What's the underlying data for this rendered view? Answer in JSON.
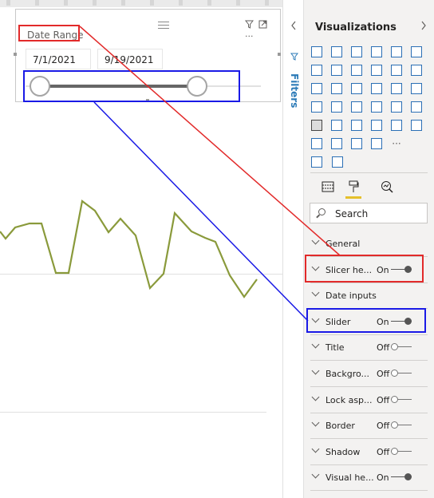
{
  "slicer": {
    "title": "Date Range",
    "start_date": "7/1/2021",
    "end_date": "9/19/2021",
    "range": {
      "start_fraction": 0.0,
      "end_fraction": 1.0
    }
  },
  "filters_pane": {
    "label": "Filters"
  },
  "visualizations_pane": {
    "title": "Visualizations",
    "more_glyph": "···",
    "search_placeholder": "Search",
    "sections": [
      {
        "name": "General",
        "state": "",
        "toggle": "none"
      },
      {
        "name": "Slicer he...",
        "state": "On",
        "toggle": "on"
      },
      {
        "name": "Date inputs",
        "state": "",
        "toggle": "none"
      },
      {
        "name": "Slider",
        "state": "On",
        "toggle": "on"
      },
      {
        "name": "Title",
        "state": "Off",
        "toggle": "off"
      },
      {
        "name": "Backgro...",
        "state": "Off",
        "toggle": "off"
      },
      {
        "name": "Lock asp...",
        "state": "Off",
        "toggle": "off"
      },
      {
        "name": "Border",
        "state": "Off",
        "toggle": "off"
      },
      {
        "name": "Shadow",
        "state": "Off",
        "toggle": "off"
      },
      {
        "name": "Visual he...",
        "state": "On",
        "toggle": "on"
      }
    ]
  },
  "colors": {
    "line_series": "#8a9a3b",
    "accent_blue": "#2b7ab7",
    "annotation_red": "#e22a2a",
    "annotation_blue": "#1a1ae6",
    "format_tab_underline": "#e5c02b"
  }
}
